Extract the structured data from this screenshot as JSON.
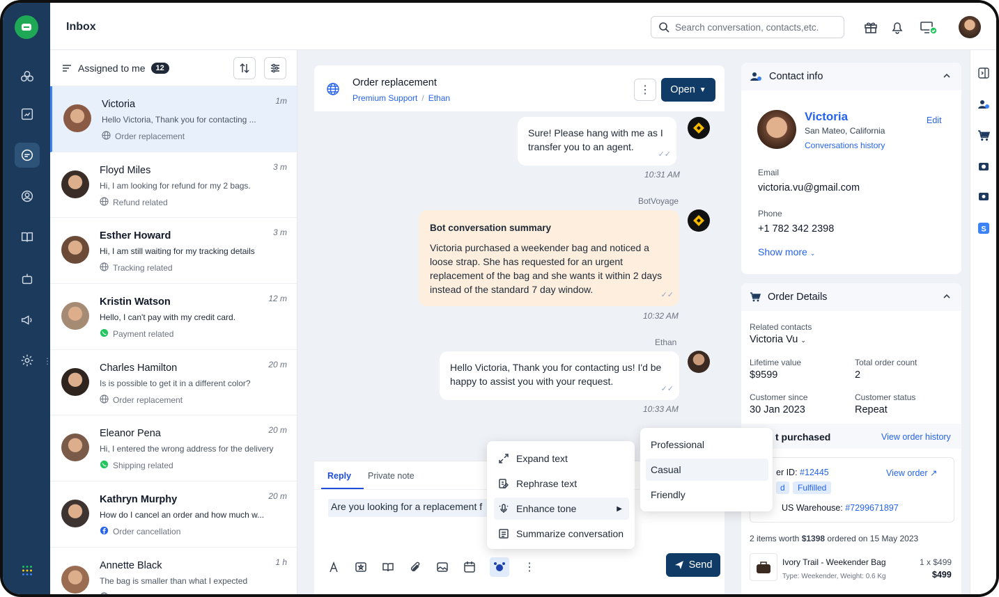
{
  "header": {
    "title": "Inbox",
    "search_placeholder": "Search conversation, contacts,etc.",
    "icons": [
      "gift-icon",
      "bell-icon",
      "monitor-status-icon",
      "avatar"
    ]
  },
  "sidebar": {
    "items": [
      "logo",
      "integrations-icon",
      "reports-icon",
      "conversations-icon",
      "contacts-icon",
      "knowledge-base-icon",
      "bot-icon",
      "campaigns-icon",
      "settings-icon",
      "apps-grid-icon"
    ],
    "active": "conversations-icon"
  },
  "list": {
    "filter_label": "Assigned to me",
    "count": "12",
    "conversations": [
      {
        "name": "Victoria",
        "time": "1m",
        "preview": "Hello Victoria, Thank you for contacting ...",
        "tag": "Order replacement",
        "tag_icon": "globe",
        "unread": false,
        "selected": true,
        "avatar_color": "#8a5a44"
      },
      {
        "name": "Floyd Miles",
        "time": "3 m",
        "preview": "Hi, I am looking for refund for my 2 bags.",
        "tag": "Refund related",
        "tag_icon": "globe",
        "unread": false,
        "avatar_color": "#3a2c26"
      },
      {
        "name": "Esther Howard",
        "time": "3 m",
        "preview": "Hi, I am still waiting for my tracking details",
        "tag": "Tracking related",
        "tag_icon": "globe",
        "unread": true,
        "avatar_color": "#6b4a38"
      },
      {
        "name": "Kristin Watson",
        "time": "12 m",
        "preview": "Hello, I can't pay with my credit card.",
        "tag": "Payment related",
        "tag_icon": "whatsapp",
        "unread": true,
        "avatar_color": "#a58a74"
      },
      {
        "name": "Charles Hamilton",
        "time": "20 m",
        "preview": "Is is possible to get it in a different color?",
        "tag": "Order replacement",
        "tag_icon": "globe",
        "unread": false,
        "avatar_color": "#2f241e"
      },
      {
        "name": "Eleanor Pena",
        "time": "20 m",
        "preview": "Hi, I entered the wrong address for the delivery",
        "tag": "Shipping related",
        "tag_icon": "whatsapp",
        "unread": false,
        "avatar_color": "#7a5a48"
      },
      {
        "name": "Kathryn Murphy",
        "time": "20 m",
        "preview": "How do I cancel an order and how much w...",
        "tag": "Order cancellation",
        "tag_icon": "facebook",
        "unread": true,
        "avatar_color": "#3d3330"
      },
      {
        "name": "Annette Black",
        "time": "1 h",
        "preview": "The bag is smaller than what I expected",
        "tag": "",
        "tag_icon": "globe",
        "unread": false,
        "avatar_color": "#9a6c52"
      }
    ]
  },
  "chat": {
    "title": "Order replacement",
    "team": "Premium Support",
    "agent": "Ethan",
    "status_button": "Open",
    "messages": [
      {
        "text": "Sure! Please hang with me as I transfer you to an agent.",
        "time": "10:31 AM",
        "sender": ""
      },
      {
        "sender": "BotVoyage",
        "heading": "Bot conversation summary",
        "text": "Victoria purchased a weekender bag and noticed a loose strap. She has requested for an urgent replacement of the bag and she wants it within 2 days instead of the standard 7 day window.",
        "time": "10:32 AM"
      },
      {
        "sender": "Ethan",
        "text": "Hello Victoria, Thank you for contacting us! I'd be happy to assist you with your request.",
        "time": "10:33 AM"
      }
    ],
    "reply_tab": "Reply",
    "note_tab": "Private note",
    "draft": "Are you looking for a replacement f",
    "send_label": "Send"
  },
  "ai_menu": {
    "items": [
      "Expand text",
      "Rephrase text",
      "Enhance tone",
      "Summarize conversation"
    ],
    "tone_options": [
      "Professional",
      "Casual",
      "Friendly"
    ]
  },
  "contact": {
    "section_title": "Contact info",
    "name": "Victoria",
    "location": "San Mateo, California",
    "history_link": "Conversations history",
    "edit_label": "Edit",
    "email_label": "Email",
    "email": "victoria.vu@gmail.com",
    "phone_label": "Phone",
    "phone": "+1 782 342 2398",
    "show_more": "Show more"
  },
  "order": {
    "section_title": "Order Details",
    "related_label": "Related contacts",
    "related_value": "Victoria Vu",
    "lifetime_label": "Lifetime value",
    "lifetime_value": "$9599",
    "total_label": "Total order count",
    "total_value": "2",
    "since_label": "Customer since",
    "since_value": "30 Jan 2023",
    "status_label": "Customer status",
    "status_value": "Repeat",
    "last_purchased": "t purchased",
    "view_history": "View order history",
    "order_id_label": "er ID:",
    "order_id": "#12445",
    "view_order": "View order",
    "badge_partial": "d",
    "badge_fulfilled": "Fulfilled",
    "warehouse_label": "US Warehouse:",
    "warehouse_id": "#7299671897",
    "summary_pre": "2 items worth ",
    "summary_amount": "$1398",
    "summary_mid": " ordered on ",
    "summary_date": "15 May 2023",
    "item_name": "Ivory Trail - Weekender Bag",
    "item_qty": "1 x $499",
    "item_meta": "Type: Weekender, Weight: 0.6 Kg",
    "item_total": "$499"
  },
  "colors": {
    "brand_dark": "#1b3a5c",
    "primary": "#0f3b66",
    "link": "#2563eb",
    "green": "#1fa855",
    "summary_bg": "#fdeedd"
  }
}
